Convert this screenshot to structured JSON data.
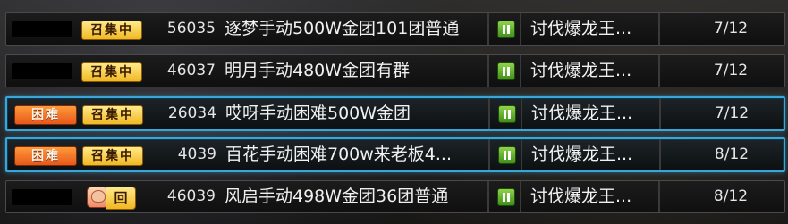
{
  "rows": [
    {
      "difficulty": "",
      "tag": "召集中",
      "id": "56035",
      "name": "逐梦手动500W金团101团普通",
      "quest": "讨伐爆龙王...",
      "count": "7/12",
      "selected": false
    },
    {
      "difficulty": "",
      "tag": "召集中",
      "id": "46037",
      "name": "明月手动480W金团有群",
      "quest": "讨伐爆龙王...",
      "count": "7/12",
      "selected": false
    },
    {
      "difficulty": "困难",
      "tag": "召集中",
      "id": "26034",
      "name": "哎呀手动困难500W金团",
      "quest": "讨伐爆龙王...",
      "count": "7/12",
      "selected": true
    },
    {
      "difficulty": "困难",
      "tag": "召集中",
      "id": "4039",
      "name": "百花手动困难700w来老板4...",
      "quest": "讨伐爆龙王...",
      "count": "8/12",
      "selected": true
    },
    {
      "difficulty": "",
      "tag": "回",
      "id": "46039",
      "name": "风启手动498W金团36团普通",
      "quest": "讨伐爆龙王...",
      "count": "8/12",
      "selected": false
    }
  ],
  "icons": {
    "status": "pause-icon",
    "return": "return-player-icon"
  },
  "colors": {
    "selected_border": "#3aa6d8",
    "hard_badge": "#e8571a",
    "gather_badge": "#f0b823",
    "status_green": "#3f8f1a"
  }
}
